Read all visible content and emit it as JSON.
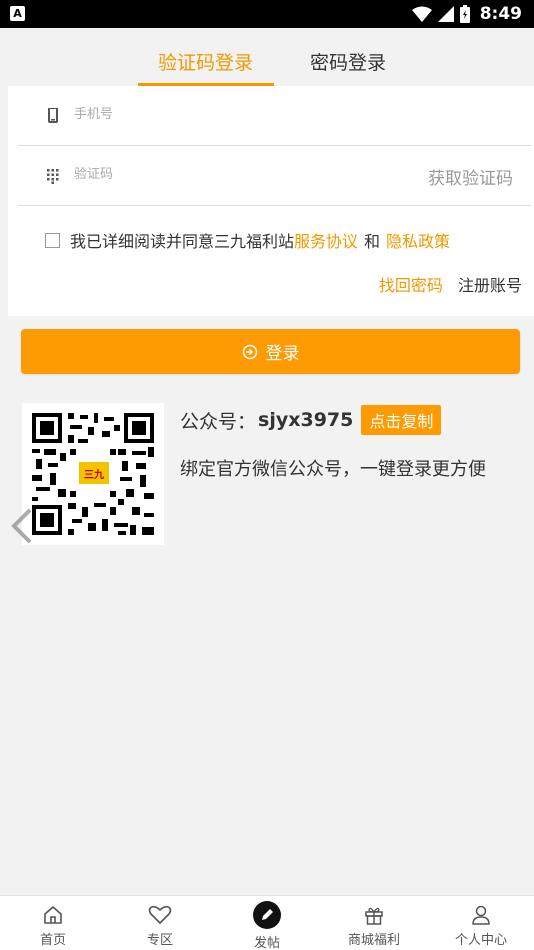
{
  "status_bar": {
    "time": "8:49",
    "app_icon_letter": "A"
  },
  "tabs": [
    {
      "label": "验证码登录",
      "active": true
    },
    {
      "label": "密码登录",
      "active": false
    }
  ],
  "form": {
    "phone_placeholder": "手机号",
    "code_placeholder": "验证码",
    "get_code_label": "获取验证码",
    "agreement": {
      "prefix": "我已详细阅读并同意三九福利站",
      "service_link": "服务协议",
      "and": "和",
      "privacy_link": "隐私政策"
    },
    "recover_password": "找回密码",
    "register": "注册账号"
  },
  "login_button": "登录",
  "public_account": {
    "label": "公众号：",
    "id": "sjyx3975",
    "copy_button": "点击复制",
    "bind_text": "绑定官方微信公众号，一键登录更方便",
    "qr_logo_text": "三九"
  },
  "bottom_nav": [
    {
      "label": "首页",
      "icon": "home-icon"
    },
    {
      "label": "专区",
      "icon": "heart-icon"
    },
    {
      "label": "发帖",
      "icon": "pencil-icon"
    },
    {
      "label": "商城福利",
      "icon": "gift-icon"
    },
    {
      "label": "个人中心",
      "icon": "user-icon"
    }
  ],
  "colors": {
    "accent": "#f39800",
    "button": "#fe9a02",
    "background": "#f2f2f2"
  }
}
